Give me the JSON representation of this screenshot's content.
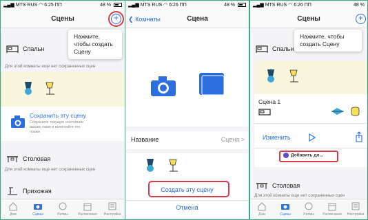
{
  "status": {
    "carrier": "MTS RUS",
    "battery": "48 %",
    "time1": "6:25 ПП",
    "time2": "6:26 ПП",
    "time3": "6:26 ПП"
  },
  "screen1": {
    "title": "Сцены",
    "tooltip": "Нажмите, чтобы создать Сцену",
    "room_bedroom": "Спальн",
    "no_scenes_text": "Для этой комнаты еще нет сохраненных сцен",
    "save_scene_label": "Сохранить эту сцену",
    "save_scene_desc": "Сохраните текущее состояние ваших ламп и включайте его позже",
    "room_dining": "Столовая",
    "no_scenes_text2": "Для этой комнаты еще нет сохраненных сцен",
    "room_hall": "Прихожая"
  },
  "screen2": {
    "back_label": "Комнаты",
    "title": "Сцена",
    "name_label": "Название",
    "name_value": "Сцена >",
    "create_button": "Создать эту сцену",
    "cancel_button": "Отмена"
  },
  "screen3": {
    "title": "Сцены",
    "tooltip": "Нажмите, чтобы создать Сцену",
    "room_bedroom": "Спальн",
    "scene_name": "Сцена 1",
    "edit_label": "Изменить",
    "add_widget": "Добавить дл...",
    "room_dining": "Столовая",
    "no_scenes_text": "Для этой комнаты еще нет сохраненных сцен"
  },
  "tabs": [
    "Дом",
    "Сцены",
    "Ритмы",
    "Расписания",
    "Настройки"
  ],
  "colors": {
    "accent": "#2a6fdb",
    "highlight": "#d83b4b"
  }
}
